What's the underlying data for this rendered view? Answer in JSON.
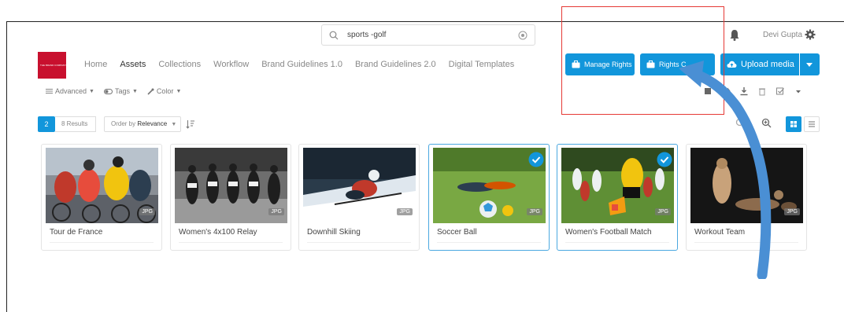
{
  "search": {
    "query": "sports -golf"
  },
  "user": {
    "name": "Devi Gupta"
  },
  "logo": {
    "text": "THE BRAND COMPANY"
  },
  "nav": [
    {
      "label": "Home",
      "active": false
    },
    {
      "label": "Assets",
      "active": true
    },
    {
      "label": "Collections",
      "active": false
    },
    {
      "label": "Workflow",
      "active": false
    },
    {
      "label": "Brand Guidelines 1.0",
      "active": false
    },
    {
      "label": "Brand Guidelines 2.0",
      "active": false
    },
    {
      "label": "Digital Templates",
      "active": false
    }
  ],
  "buttons": {
    "manage_rights": "Manage Rights",
    "rights_other": "Rights C",
    "upload": "Upload media"
  },
  "filters": {
    "advanced": "Advanced",
    "tags": "Tags",
    "color": "Color"
  },
  "results": {
    "selected_count": "2",
    "count_label": "8 Results",
    "order_prefix": "Order by",
    "order_value": "Relevance"
  },
  "assets": [
    {
      "title": "Tour de France",
      "badge": "JPG",
      "selected": false
    },
    {
      "title": "Women's 4x100 Relay",
      "badge": "JPG",
      "selected": false
    },
    {
      "title": "Downhill Skiing",
      "badge": "JPG",
      "selected": false
    },
    {
      "title": "Soccer Ball",
      "badge": "JPG",
      "selected": true
    },
    {
      "title": "Women's Football Match",
      "badge": "JPG",
      "selected": true
    },
    {
      "title": "Workout Team",
      "badge": "JPG",
      "selected": false
    }
  ],
  "colors": {
    "accent": "#1296db",
    "highlight_box": "#e53935",
    "arrow": "#4a8fd4",
    "logo": "#c8102e"
  }
}
